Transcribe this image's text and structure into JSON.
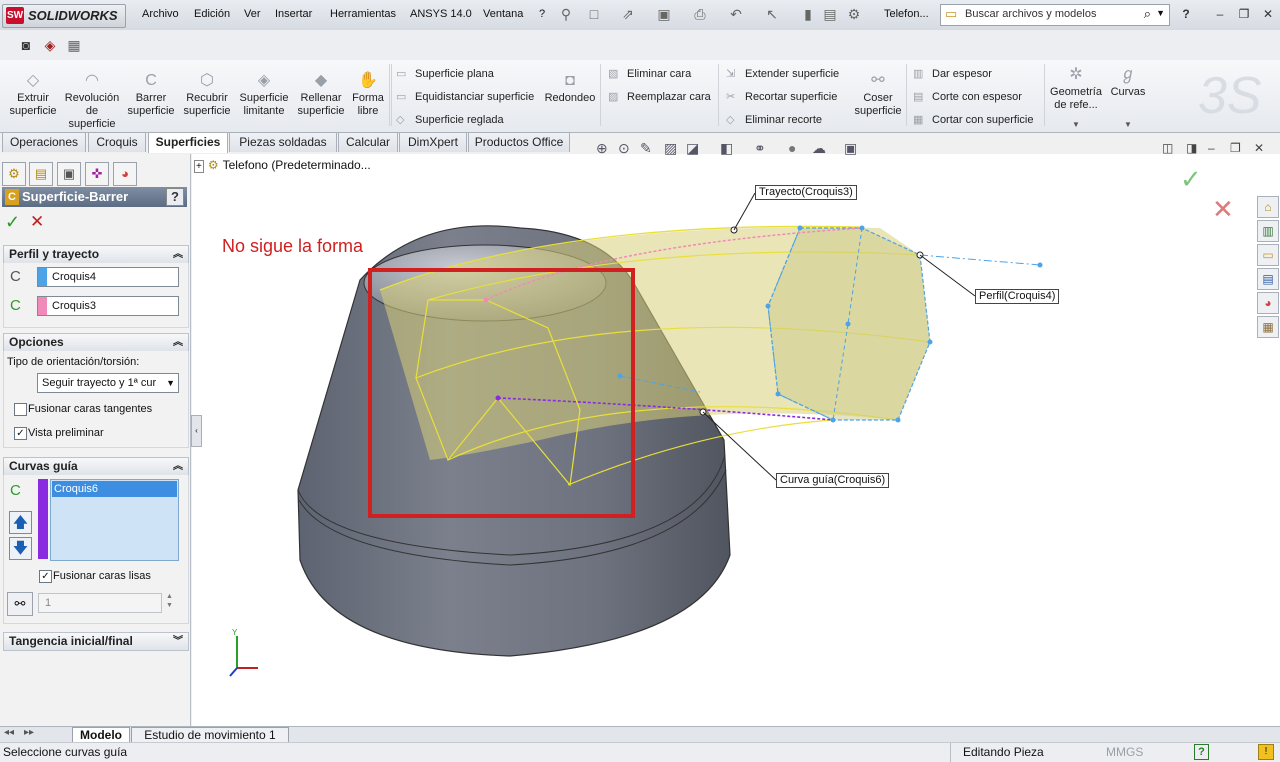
{
  "app": {
    "logo_text": "SOLIDWORKS",
    "logo_mark": "SW"
  },
  "menu": [
    "Archivo",
    "Edición",
    "Ver",
    "Insertar",
    "Herramientas",
    "ANSYS 14.0",
    "Ventana",
    "?"
  ],
  "document_title": "Telefon...",
  "search": {
    "value": "Buscar archivos y modelos"
  },
  "ribbon": {
    "big": [
      {
        "label": "Extruir superficie",
        "icon": "extrude-surface-icon"
      },
      {
        "label": "Revolución de superficie",
        "icon": "revolve-surface-icon"
      },
      {
        "label": "Barrer superficie",
        "icon": "sweep-surface-icon"
      },
      {
        "label": "Recubrir superficie",
        "icon": "loft-surface-icon"
      },
      {
        "label": "Superficie limitante",
        "icon": "boundary-surface-icon"
      },
      {
        "label": "Rellenar superficie",
        "icon": "fill-surface-icon"
      },
      {
        "label": "Forma libre",
        "icon": "freeform-icon"
      }
    ],
    "group1": [
      "Superficie plana",
      "Equidistanciar superficie",
      "Superficie reglada"
    ],
    "redondeo": "Redondeo",
    "group2": [
      "Eliminar cara",
      "Reemplazar cara"
    ],
    "group3": [
      "Extender superficie",
      "Recortar superficie",
      "Eliminar recorte"
    ],
    "coser": "Coser superficie",
    "group4": [
      "Dar espesor",
      "Corte con espesor",
      "Cortar con superficie"
    ],
    "geometria": "Geometría de refe...",
    "curvas": "Curvas"
  },
  "tabs": [
    "Operaciones",
    "Croquis",
    "Superficies",
    "Piezas soldadas",
    "Calcular",
    "DimXpert",
    "Productos Office"
  ],
  "active_tab": "Superficies",
  "tree": {
    "root": "Telefono  (Predeterminado..."
  },
  "property_manager": {
    "title": "Superficie-Barrer",
    "help": "?",
    "perfil_trayecto": {
      "header": "Perfil y trayecto",
      "profile": "Croquis4",
      "path": "Croquis3",
      "profile_color": "#4da3e8",
      "path_color": "#f08ab8"
    },
    "opciones": {
      "header": "Opciones",
      "orient_label": "Tipo de orientación/torsión:",
      "orient_value": "Seguir trayecto y 1ª cur",
      "fusionar_tangentes": "Fusionar caras tangentes",
      "fusionar_tangentes_checked": false,
      "vista_preliminar": "Vista preliminar",
      "vista_preliminar_checked": true
    },
    "curvas_guia": {
      "header": "Curvas guía",
      "items": [
        "Croquis6"
      ],
      "guide_color": "#8a2be2",
      "fusionar_lisas": "Fusionar caras lisas",
      "fusionar_lisas_checked": true,
      "spin_value": "1"
    },
    "tangencia": {
      "header": "Tangencia inicial/final"
    }
  },
  "viewport": {
    "annotation": "No sigue la forma",
    "annotation_color": "#d02020",
    "callouts": {
      "trayecto": "Trayecto(Croquis3)",
      "perfil": "Perfil(Croquis4)",
      "curva": "Curva guía(Croquis6)"
    }
  },
  "bottom_tabs": [
    "Modelo",
    "Estudio de movimiento 1"
  ],
  "status": {
    "left": "Seleccione curvas guía",
    "mode": "Editando Pieza",
    "units": "MMGS",
    "help": "?"
  }
}
